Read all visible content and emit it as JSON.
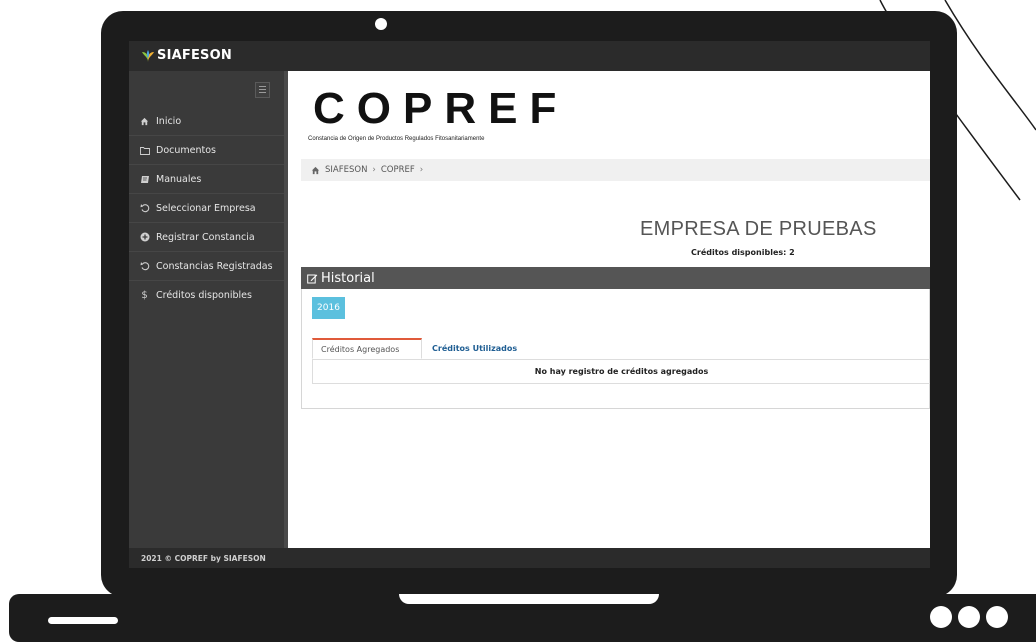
{
  "colors": {
    "frame": "#1c1c1c",
    "topbar": "#2b2b2b",
    "sidebar": "#3a3a3a",
    "panel_header": "#555555",
    "year_button": "#5bc0de",
    "active_tab_border": "#e05a3a",
    "link": "#1f5e93"
  },
  "brand": {
    "name": "SIAFESON",
    "icon": "leaf-logo-icon"
  },
  "sidebar": {
    "items": [
      {
        "label": "Inicio",
        "icon": "home-icon"
      },
      {
        "label": "Documentos",
        "icon": "folder-icon"
      },
      {
        "label": "Manuales",
        "icon": "book-icon"
      },
      {
        "label": "Seleccionar Empresa",
        "icon": "undo-icon"
      },
      {
        "label": "Registrar Constancia",
        "icon": "plus-circle-icon"
      },
      {
        "label": "Constancias Registradas",
        "icon": "undo-icon"
      },
      {
        "label": "Créditos disponibles",
        "icon": "dollar-icon"
      }
    ]
  },
  "header": {
    "logo": "COPREF",
    "subtitle": "Constancia de Origen de Productos Regulados Fitosanitariamente"
  },
  "breadcrumb": {
    "items": [
      "SIAFESON",
      "COPREF"
    ]
  },
  "company": {
    "name": "EMPRESA DE PRUEBAS",
    "credits_label": "Créditos disponibles: 2"
  },
  "historial": {
    "title": "Historial",
    "year": "2016",
    "tabs": [
      "Créditos Agregados",
      "Créditos Utilizados"
    ],
    "empty_message": "No hay registro de créditos agregados"
  },
  "footer": {
    "text": "2021 © COPREF by SIAFESON"
  }
}
